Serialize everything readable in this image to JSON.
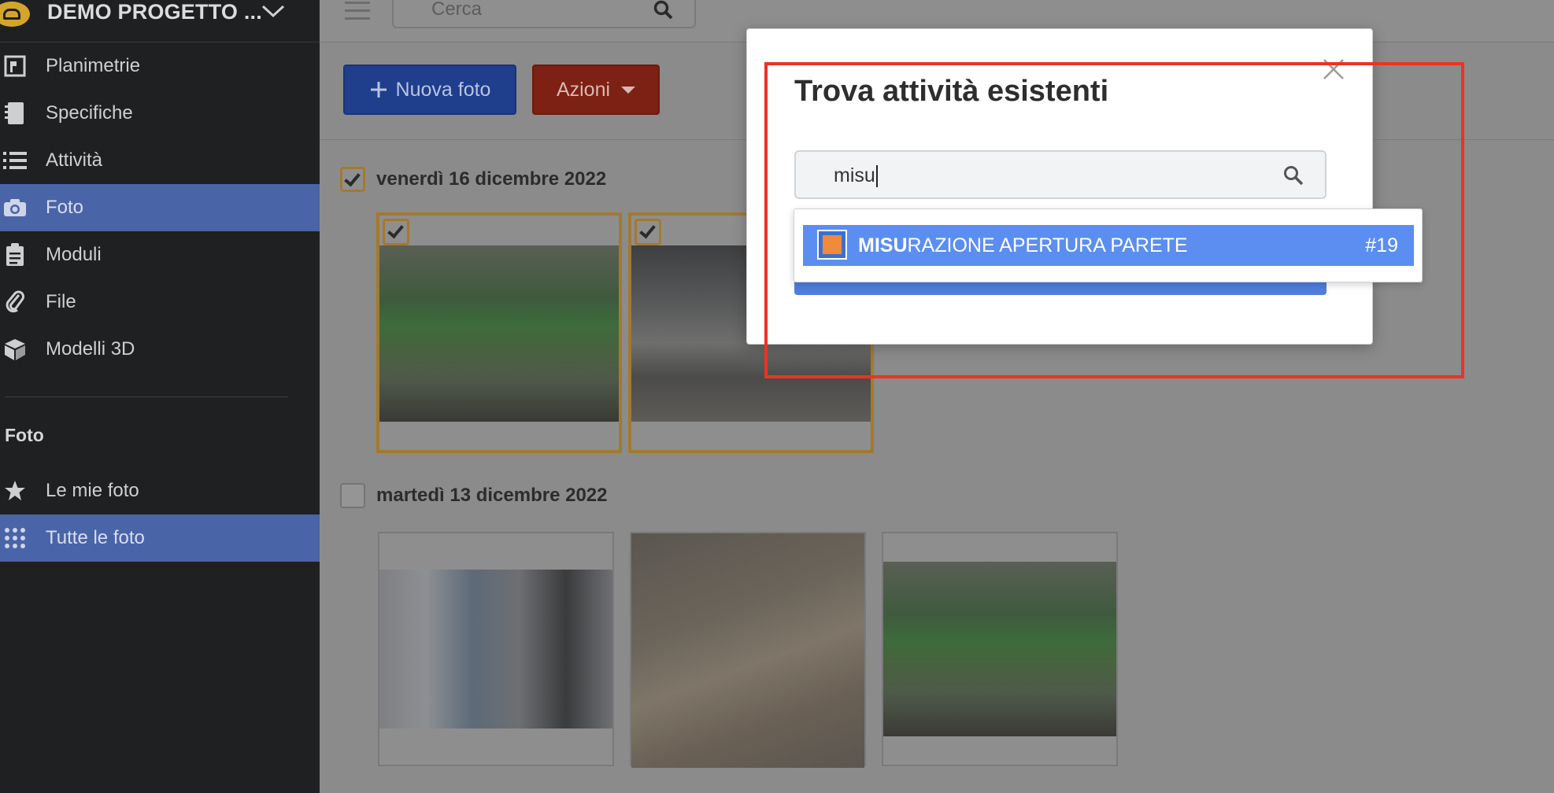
{
  "colors": {
    "accent_blue": "#5b8ef0",
    "sidebar_bg": "#1f2022",
    "sidebar_active": "#4a64a8",
    "annotation_red": "#ec3323",
    "selection_gold": "#a27a2e",
    "status_orange": "#f08a3c"
  },
  "sidebar": {
    "project_title": "DEMO PROGETTO ...",
    "items": [
      {
        "label": "Planimetrie",
        "icon": "floorplan-icon"
      },
      {
        "label": "Specifiche",
        "icon": "notebook-icon"
      },
      {
        "label": "Attività",
        "icon": "list-icon"
      },
      {
        "label": "Foto",
        "icon": "camera-icon",
        "active": true
      },
      {
        "label": "Moduli",
        "icon": "clipboard-icon"
      },
      {
        "label": "File",
        "icon": "paperclip-icon"
      },
      {
        "label": "Modelli 3D",
        "icon": "cube-icon"
      }
    ],
    "section_heading": "Foto",
    "sub_items": [
      {
        "label": "Le mie foto",
        "icon": "star-icon"
      },
      {
        "label": "Tutte le foto",
        "icon": "grid-icon",
        "active": true
      }
    ]
  },
  "topbar": {
    "search_placeholder": "Cerca"
  },
  "toolbar": {
    "new_photo_label": "Nuova foto",
    "actions_label": "Azioni"
  },
  "groups": [
    {
      "date": "venerdì 16 dicembre 2022",
      "checked": true,
      "photos": [
        "scissor-lift",
        "ceiling"
      ]
    },
    {
      "date": "martedì 13 dicembre 2022",
      "checked": false,
      "photos": [
        "boiler-tanks",
        "floor-materials",
        "scissor-lift"
      ]
    }
  ],
  "modal": {
    "title": "Trova attività esistenti",
    "search_value": "misu",
    "result": {
      "match": "MISU",
      "rest": "RAZIONE APERTURA PARETE",
      "number": "#19"
    }
  }
}
